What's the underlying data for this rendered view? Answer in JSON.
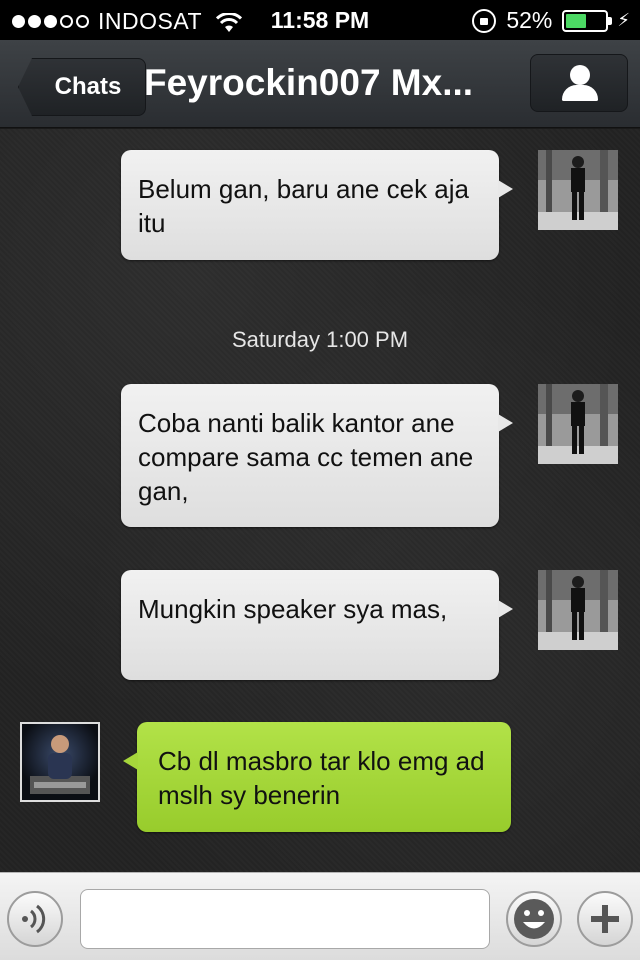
{
  "status_bar": {
    "carrier": "INDOSAT",
    "time": "11:58 PM",
    "battery_percent": "52%",
    "battery_level": 0.52,
    "signal_bars_filled": 3,
    "signal_bars_total": 5,
    "icons": [
      "wifi-icon",
      "rotation-lock-icon",
      "battery-icon",
      "charging-icon"
    ]
  },
  "nav": {
    "back_label": "Chats",
    "title": "Feyrockin007 Mx...",
    "profile_icon": "person-icon"
  },
  "messages": [
    {
      "direction": "out",
      "text": "Belum gan, baru ane cek aja itu"
    },
    {
      "direction": "out",
      "text": "Coba nanti balik kantor ane compare sama cc temen ane gan,"
    },
    {
      "direction": "out",
      "text": "Mungkin speaker sya mas,"
    },
    {
      "direction": "in",
      "text": "Cb dl masbro tar klo emg ad mslh sy benerin"
    }
  ],
  "timestamp": "Saturday 1:00 PM",
  "colors": {
    "incoming_bubble": "#a6d63b",
    "outgoing_bubble": "#e8e8e8",
    "nav_bar": "#35383c",
    "battery_fill": "#4cd964"
  },
  "input": {
    "value": "",
    "placeholder": "",
    "left_button_icon": "voice-icon",
    "emoji_button_icon": "emoji-icon",
    "plus_button_icon": "plus-icon"
  }
}
